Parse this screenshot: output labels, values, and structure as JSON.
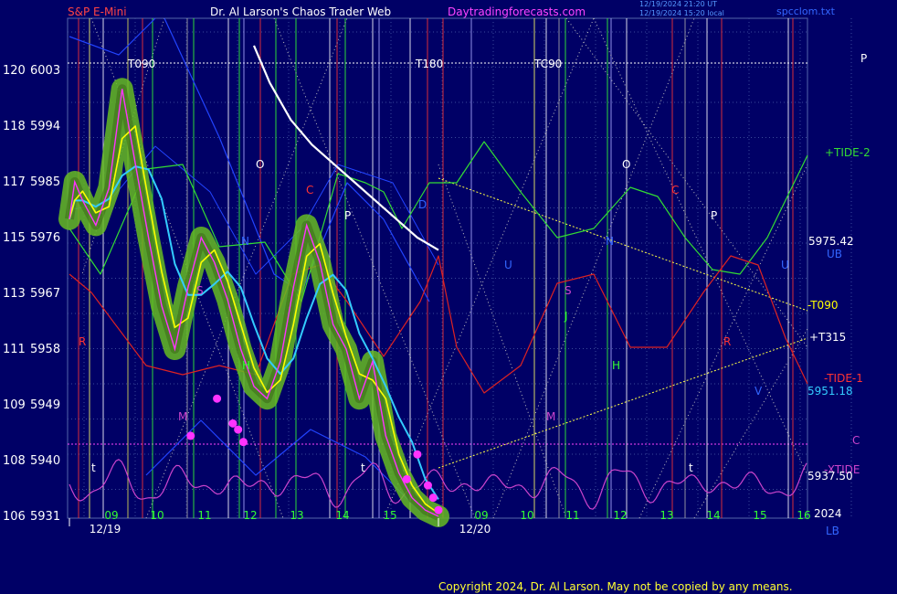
{
  "header": {
    "symbol": "S&P E-Mini",
    "title": "Dr. Al Larson's Chaos Trader Web",
    "site": "Daytradingforecasts.com",
    "stamp1": "12/19/2024 21:20 UT",
    "stamp2": "12/19/2024 15:20 local",
    "filename": "spcclom.txt"
  },
  "footer": {
    "copyright": "Copyright 2024, Dr. Al Larson. May not be copied by any means."
  },
  "colors": {
    "background": "#000066",
    "grid": "#3a4a9a",
    "price_blob": "#66bb22",
    "price_line": "#ff33ff",
    "yellow_avg": "#ffff00",
    "cyan_avg": "#33ccff",
    "white_line": "#ffffff",
    "tide2_green": "#33dd33",
    "tide1_red": "#dd2222",
    "blue_channel": "#2244ff",
    "magenta_osc": "#cc44cc",
    "dotted_lines": "#c0c0c0"
  },
  "chart_data": {
    "type": "line",
    "title": "",
    "xlabel": "",
    "ylabel": "",
    "ylim": [
      106,
      120
    ],
    "y_ticks": [
      {
        "left": "106",
        "right": "5931"
      },
      {
        "left": "108",
        "right": "5940"
      },
      {
        "left": "109",
        "right": "5949"
      },
      {
        "left": "111",
        "right": "5958"
      },
      {
        "left": "113",
        "right": "5967"
      },
      {
        "left": "115",
        "right": "5976"
      },
      {
        "left": "117",
        "right": "5985"
      },
      {
        "left": "118",
        "right": "5994"
      },
      {
        "left": "120",
        "right": "6003"
      }
    ],
    "x_hour_labels": [
      "09",
      "10",
      "11",
      "12",
      "13",
      "14",
      "15",
      "09",
      "10",
      "11",
      "12",
      "13",
      "14",
      "15",
      "16"
    ],
    "x_date_labels": [
      "12/19",
      "12/20"
    ],
    "price_series": {
      "name": "S&P E-Mini",
      "x": [
        0,
        0.1,
        0.25,
        0.5,
        0.75,
        1,
        1.25,
        1.5,
        1.75,
        2,
        2.25,
        2.5,
        2.75,
        3,
        3.25,
        3.5,
        3.75,
        4,
        4.25,
        4.5,
        4.75,
        5,
        5.25,
        5.5,
        5.75,
        6,
        6.25,
        6.5,
        6.75,
        7
      ],
      "y": [
        5979,
        5985,
        5982,
        5978,
        5984,
        6000,
        5988,
        5976,
        5965,
        5958,
        5968,
        5976,
        5972,
        5966,
        5958,
        5952,
        5950,
        5956,
        5968,
        5978,
        5972,
        5962,
        5958,
        5950,
        5956,
        5944,
        5938,
        5934,
        5932,
        5931
      ]
    },
    "price_dots": {
      "x": [
        2.3,
        2.8,
        3.1,
        3.2,
        3.3,
        6.4,
        6.6,
        6.8,
        6.9,
        7.0
      ],
      "y": [
        5944,
        5950,
        5946,
        5945,
        5943,
        5937,
        5941,
        5936,
        5934,
        5932
      ]
    },
    "white_line": {
      "x": [
        3.5,
        3.8,
        4.2,
        4.6,
        5.0,
        5.4,
        5.8,
        6.2,
        6.6,
        7.0
      ],
      "y": [
        6007,
        6001,
        5995,
        5991,
        5988,
        5985,
        5982,
        5979,
        5976,
        5974
      ]
    },
    "right_labels": [
      {
        "text": "P",
        "color": "#ffffff"
      },
      {
        "text": "+TIDE-2",
        "color": "#33dd33"
      },
      {
        "text": "5975.42",
        "color": "#ffffff"
      },
      {
        "text": "UB",
        "color": "#3366ff"
      },
      {
        "text": "-T090",
        "color": "#ffff00"
      },
      {
        "text": "+T315",
        "color": "#ffffff"
      },
      {
        "text": "-TIDE-1",
        "color": "#ff3333"
      },
      {
        "text": "5951.18",
        "color": "#33ccff"
      },
      {
        "text": "C",
        "color": "#cc44cc"
      },
      {
        "text": "-XTIDE",
        "color": "#cc44cc"
      },
      {
        "text": "5937.50",
        "color": "#ffffff"
      },
      {
        "text": "2024",
        "color": "#ffffff"
      },
      {
        "text": "LB",
        "color": "#3366ff"
      }
    ],
    "top_labels": [
      "T090",
      "T180",
      "TC90"
    ],
    "inner_letters": [
      "O",
      "C",
      "P",
      "R",
      "S",
      "M",
      "H",
      "J",
      "N",
      "U",
      "V",
      "t",
      "D"
    ]
  }
}
